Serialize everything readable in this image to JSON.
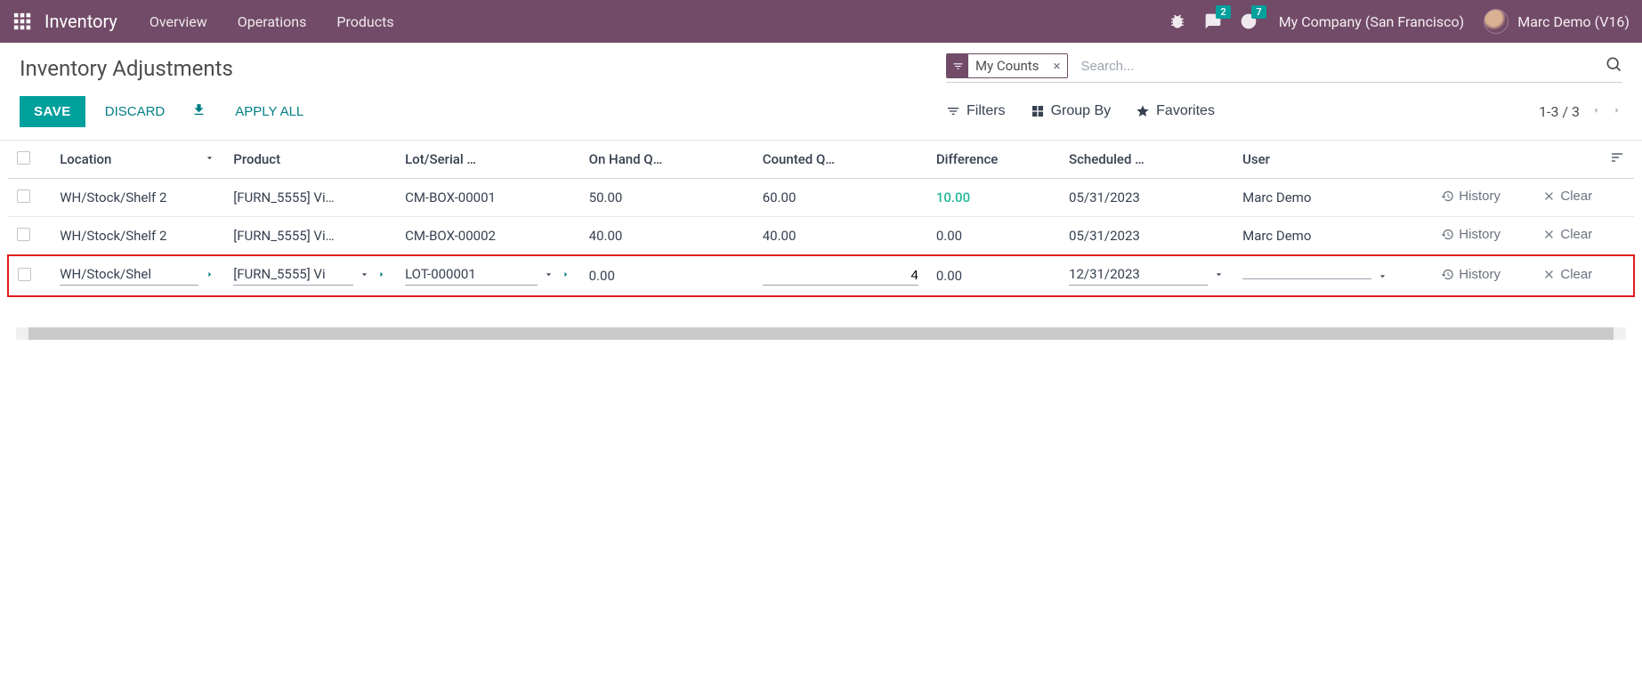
{
  "topbar": {
    "app_name": "Inventory",
    "menu": [
      "Overview",
      "Operations",
      "Products"
    ],
    "msg_badge": "2",
    "activity_badge": "7",
    "company": "My Company (San Francisco)",
    "user": "Marc Demo (V16)"
  },
  "control_panel": {
    "title": "Inventory Adjustments",
    "save": "SAVE",
    "discard": "DISCARD",
    "apply_all": "APPLY ALL",
    "search_facet": "My Counts",
    "search_placeholder": "Search...",
    "filters": "Filters",
    "group_by": "Group By",
    "favorites": "Favorites",
    "pager": "1-3 / 3"
  },
  "table": {
    "headers": {
      "location": "Location",
      "product": "Product",
      "lot": "Lot/Serial …",
      "onhand": "On Hand Q…",
      "counted": "Counted Q…",
      "difference": "Difference",
      "scheduled": "Scheduled …",
      "user": "User"
    },
    "actions": {
      "history": "History",
      "clear": "Clear"
    },
    "rows": [
      {
        "location": "WH/Stock/Shelf 2",
        "product": "[FURN_5555] Vi…",
        "lot": "CM-BOX-00001",
        "onhand": "50.00",
        "counted": "60.00",
        "difference": "10.00",
        "diff_positive": true,
        "scheduled": "05/31/2023",
        "user": "Marc Demo",
        "editing": false
      },
      {
        "location": "WH/Stock/Shelf 2",
        "product": "[FURN_5555] Vi…",
        "lot": "CM-BOX-00002",
        "onhand": "40.00",
        "counted": "40.00",
        "difference": "0.00",
        "diff_positive": false,
        "scheduled": "05/31/2023",
        "user": "Marc Demo",
        "editing": false
      },
      {
        "location": "WH/Stock/Shel",
        "product": "[FURN_5555] Vi",
        "lot": "LOT-000001",
        "onhand": "0.00",
        "counted": "4",
        "difference": "0.00",
        "diff_positive": false,
        "scheduled": "12/31/2023",
        "user": "",
        "editing": true
      }
    ]
  }
}
